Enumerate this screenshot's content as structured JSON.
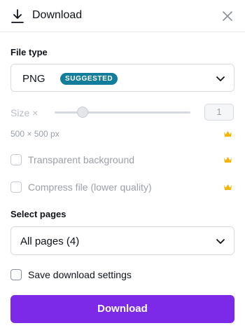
{
  "header": {
    "title": "Download",
    "download_icon": "download-icon",
    "close_icon": "close-icon"
  },
  "file_type": {
    "label": "File type",
    "value": "PNG",
    "badge": "SUGGESTED",
    "badge_color": "#137e9c"
  },
  "size": {
    "label": "Size ×",
    "value": "1",
    "dimensions": "500 × 500 px",
    "premium_icon": "crown-icon",
    "slider_fraction": 0.2
  },
  "options": {
    "transparent_label": "Transparent background",
    "compress_label": "Compress file (lower quality)"
  },
  "pages": {
    "label": "Select pages",
    "value": "All pages (4)"
  },
  "save_settings": {
    "label": "Save download settings"
  },
  "download_button": {
    "label": "Download",
    "color": "#7d2ae8"
  }
}
